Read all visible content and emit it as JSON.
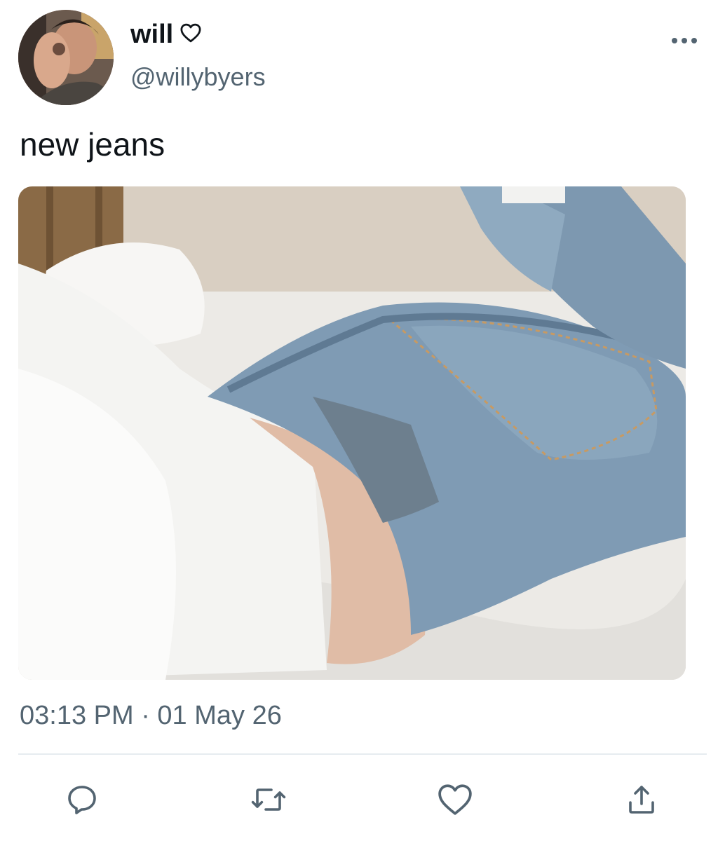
{
  "user": {
    "display_name": "will",
    "handle": "@willybyers",
    "name_badge_icon": "heart-outline-icon",
    "avatar": "profile-photo"
  },
  "tweet": {
    "text": "new jeans",
    "image": "photo-person-in-white-tshirt-and-blue-jeans-lying-on-bed",
    "timestamp": "03:13 PM · 01 May 26"
  },
  "menu": {
    "icon": "more-horizontal-icon"
  },
  "actions": [
    {
      "name": "reply",
      "icon": "reply-bubble-icon"
    },
    {
      "name": "retweet",
      "icon": "retweet-icon"
    },
    {
      "name": "like",
      "icon": "heart-outline-icon"
    },
    {
      "name": "share",
      "icon": "share-upload-icon"
    }
  ],
  "colors": {
    "text_primary": "#0f1419",
    "text_secondary": "#536471",
    "divider": "#e6ecf0",
    "icon": "#536471",
    "background": "#ffffff"
  }
}
